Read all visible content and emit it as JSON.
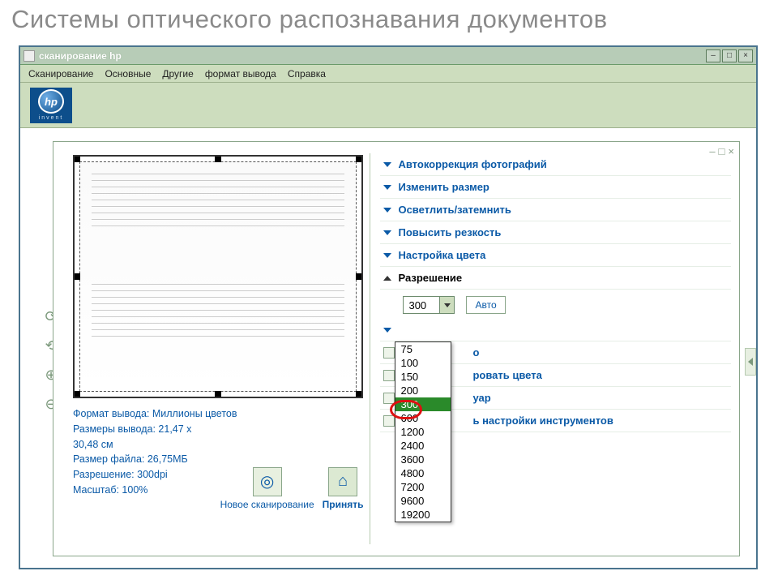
{
  "slide_title": "Системы оптического распознавания документов",
  "window": {
    "title": "сканирование hp"
  },
  "menu": [
    "Сканирование",
    "Основные",
    "Другие",
    "формат вывода",
    "Справка"
  ],
  "logo": {
    "text": "hp",
    "sub": "invent"
  },
  "info": {
    "line1": "Формат вывода: Миллионы цветов",
    "line2a": "Размеры вывода: 21,47 x",
    "line2b": "30,48 см",
    "line3": "Размер файла: 26,75МБ",
    "line4": "Разрешение:  300dpi",
    "line5": "Масштаб: 100%"
  },
  "actions": {
    "new_scan": "Новое сканирование",
    "accept": "Принять"
  },
  "tools": {
    "rotate_cw": "rotate-cw-icon",
    "rotate_ccw": "rotate-ccw-icon",
    "zoom_in": "zoom-in-icon",
    "zoom_out": "zoom-out-icon"
  },
  "accordion": {
    "items": [
      "Автокоррекция фотографий",
      "Изменить размер",
      "Осветлить/затемнить",
      "Повысить резкость",
      "Настройка цвета"
    ],
    "expanded": "Разрешение",
    "auto_btn": "Авто",
    "combo_value": "300",
    "options": [
      "75",
      "100",
      "150",
      "200",
      "300",
      "600",
      "1200",
      "2400",
      "3600",
      "4800",
      "7200",
      "9600",
      "19200"
    ],
    "selected": "300",
    "partial_rows": [
      "о",
      "ровать цвета",
      "уар",
      "ь настройки инструментов"
    ]
  }
}
